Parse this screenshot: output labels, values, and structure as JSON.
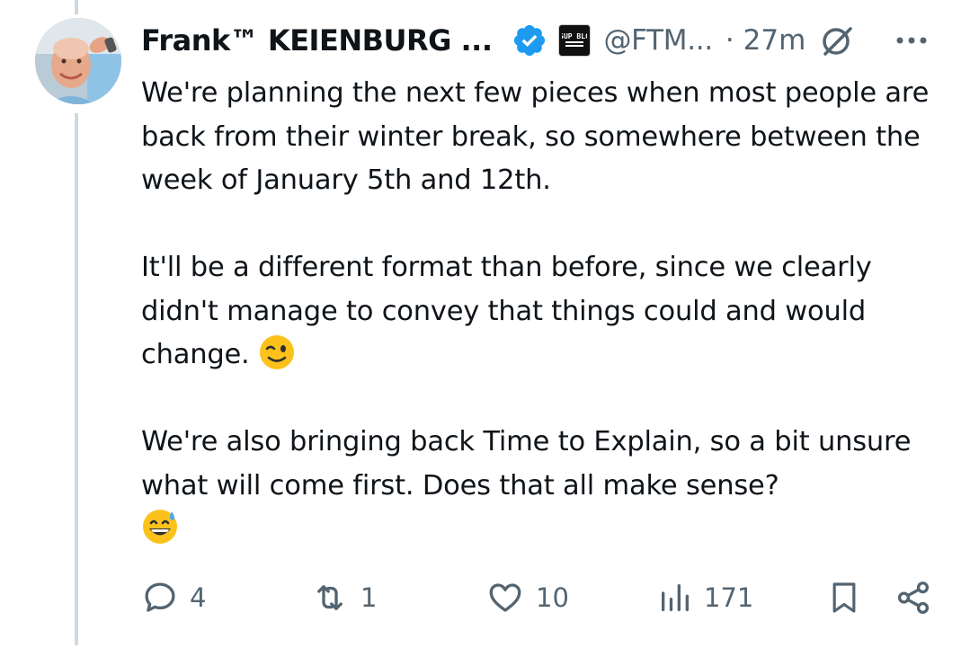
{
  "tweet": {
    "author": {
      "display_name": "Frank™ KEIENBURG ...",
      "handle": "@FTM...",
      "avatar_icon": "avatar-photo",
      "verified_icon": "verified-badge-icon",
      "affiliate_icon": "affiliate-logo-icon",
      "affiliate_text": "SUP BLC"
    },
    "timestamp": "· 27m",
    "paragraphs": [
      "We're planning the next few pieces when most people are back from their winter break, so somewhere between the week of January 5th and 12th.",
      "It'll be a different format than before, since we clearly didn't manage to convey that things could and would change.",
      "We're also bringing back Time to Explain, so a bit unsure what will come first. Does that all make sense?"
    ],
    "emojis": [
      "winking-face",
      "grinning-face-with-sweat"
    ],
    "actions": {
      "replies": "4",
      "reposts": "1",
      "likes": "10",
      "views": "171"
    }
  },
  "colors": {
    "text": "#0f1419",
    "secondary": "#536471",
    "verified": "#1d9bf0",
    "thread_line": "#cfd9de"
  }
}
